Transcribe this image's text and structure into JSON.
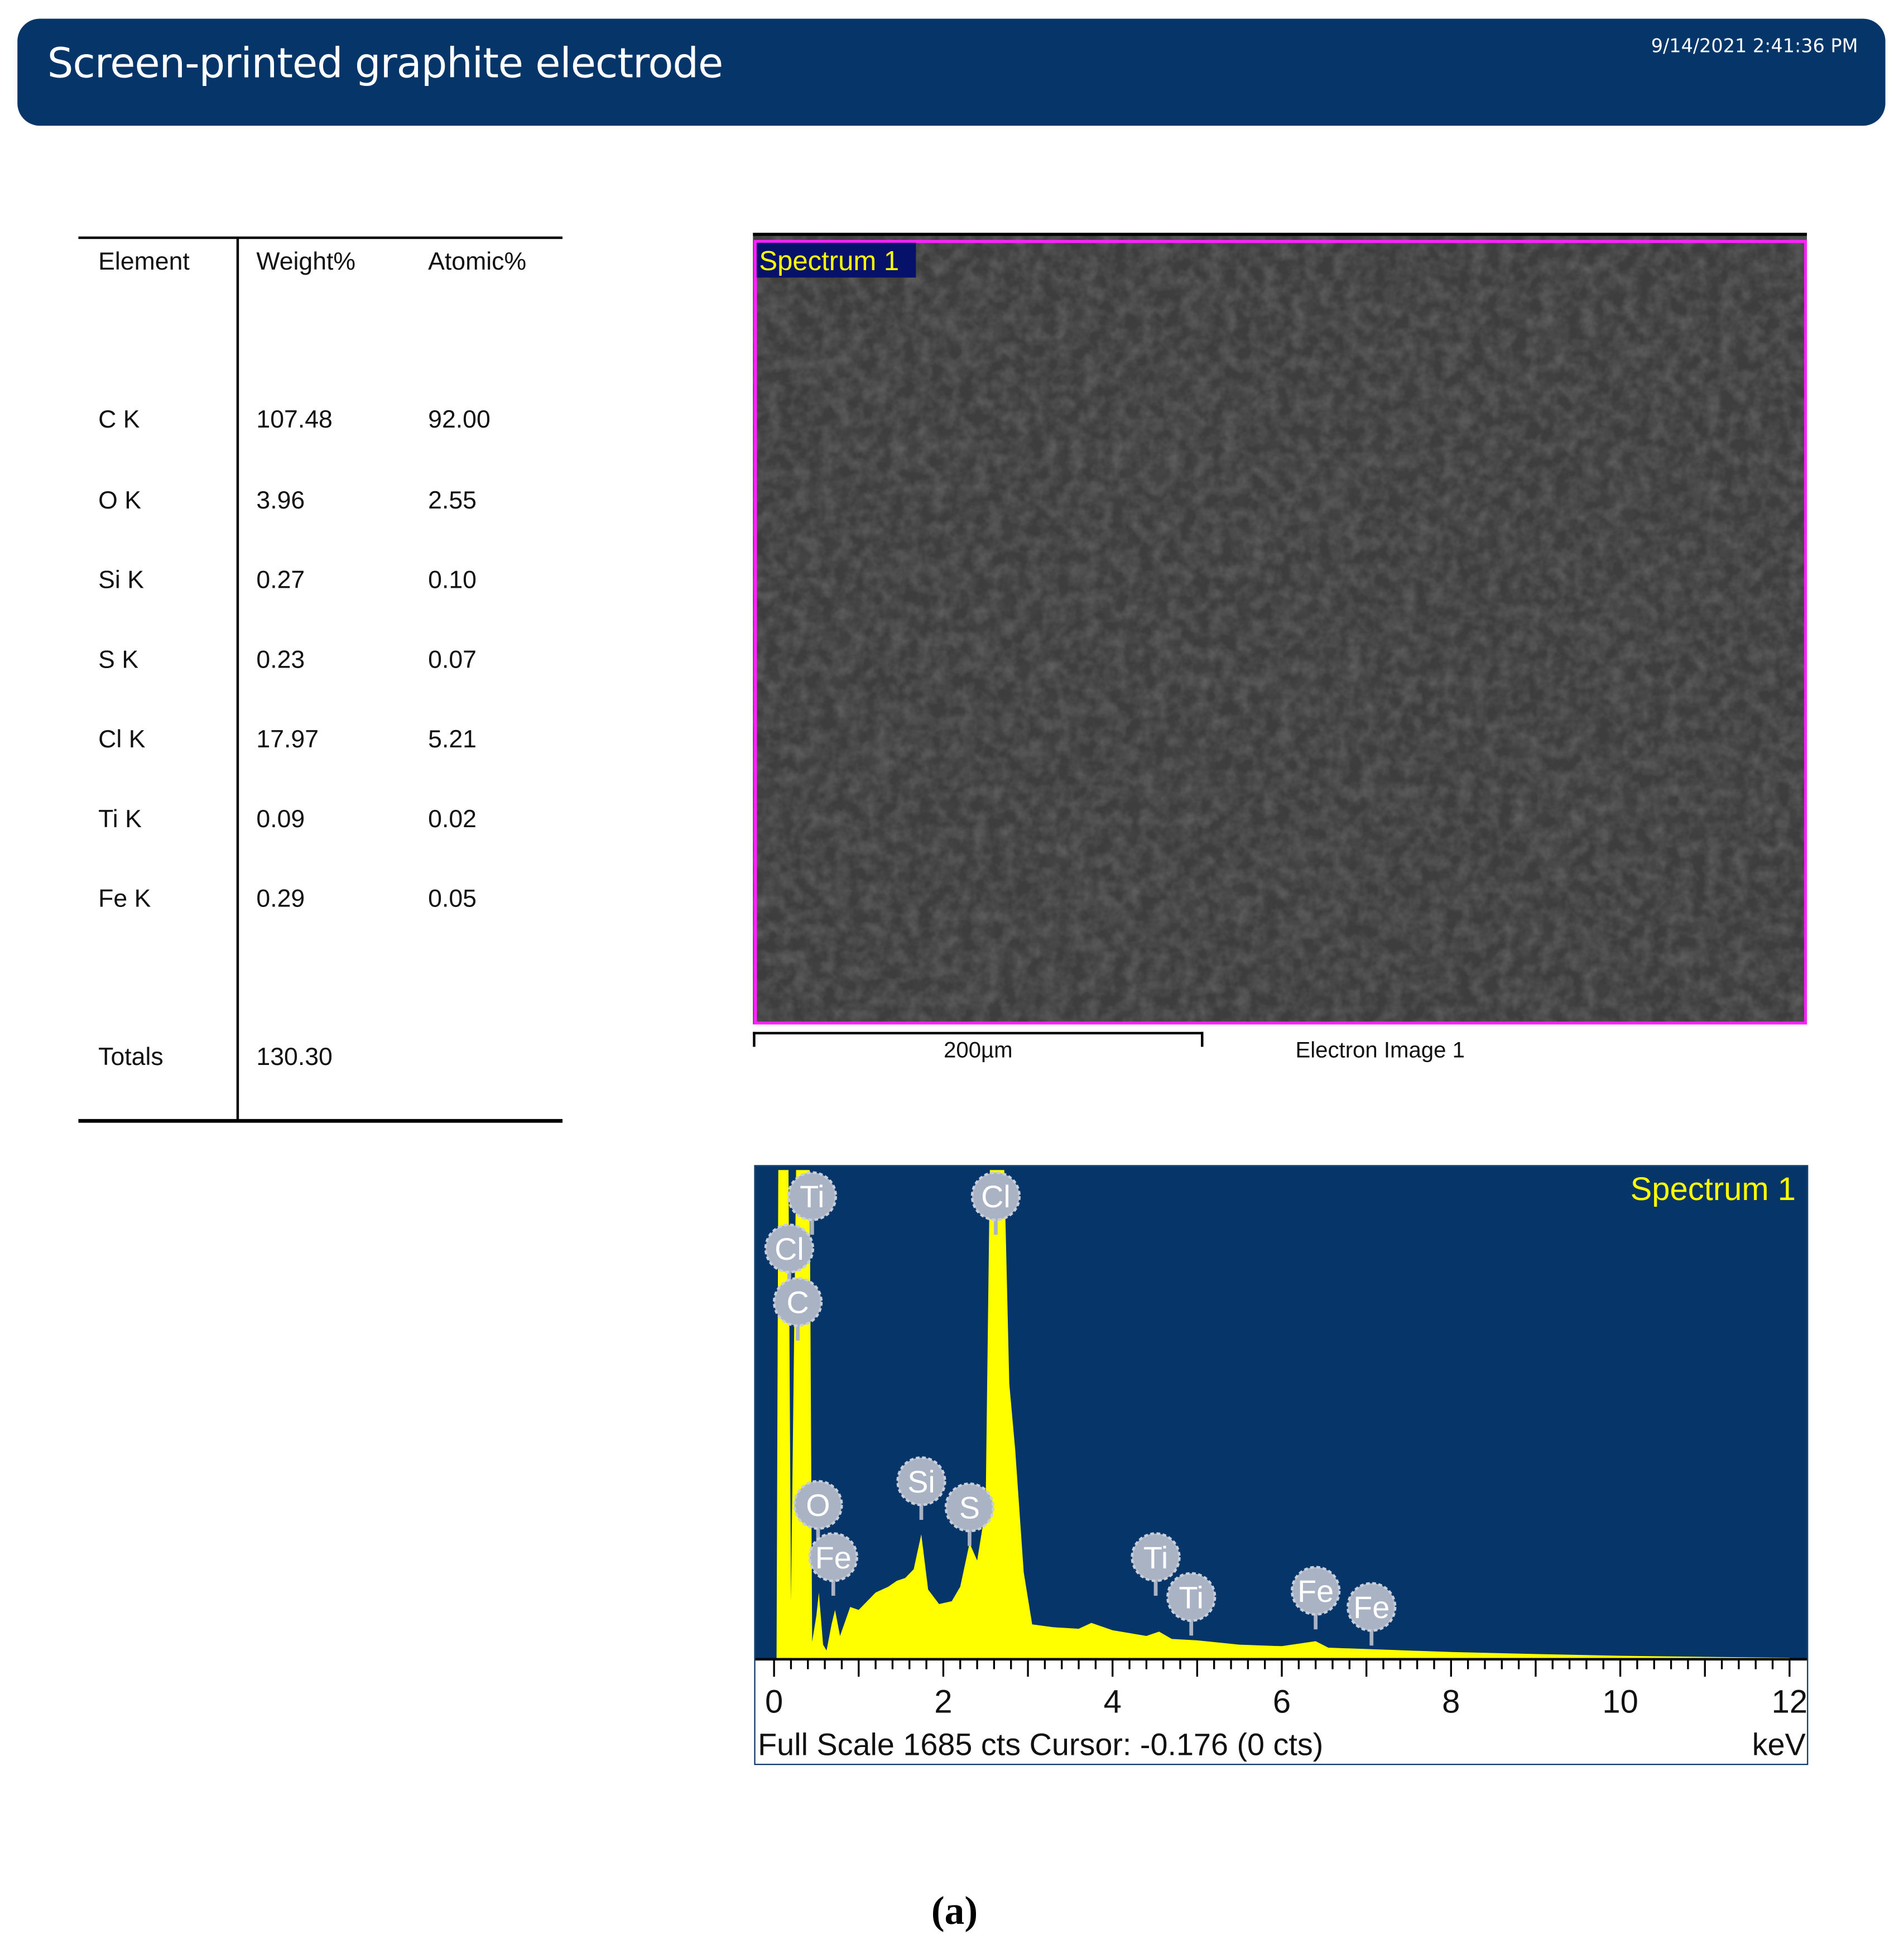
{
  "header": {
    "title": "Screen-printed graphite electrode",
    "timestamp": "9/14/2021 2:41:36 PM"
  },
  "table": {
    "columns": [
      "Element",
      "Weight%",
      "Atomic%"
    ],
    "rows": [
      [
        "C K",
        "107.48",
        "92.00"
      ],
      [
        "O K",
        "3.96",
        "2.55"
      ],
      [
        "Si K",
        "0.27",
        "0.10"
      ],
      [
        "S K",
        "0.23",
        "0.07"
      ],
      [
        "Cl K",
        "17.97",
        "5.21"
      ],
      [
        "Ti K",
        "0.09",
        "0.02"
      ],
      [
        "Fe K",
        "0.29",
        "0.05"
      ]
    ],
    "totals_label": "Totals",
    "totals_weight": "130.30"
  },
  "electron_image": {
    "spectrum_label": "Spectrum 1",
    "scale_label": "200µm",
    "caption": "Electron Image 1"
  },
  "chart_data": {
    "type": "area",
    "title": "Spectrum 1",
    "xlabel": "keV",
    "xlim": [
      0,
      12
    ],
    "ylim": [
      0,
      1685
    ],
    "xticks": [
      "0",
      "2",
      "4",
      "6",
      "8",
      "10",
      "12"
    ],
    "status": "Full Scale 1685 cts Cursor: -0.176  (0 cts)",
    "colors": {
      "background": "#06356a",
      "fill": "#ffff00",
      "marker": "#a9b3c4"
    },
    "series": [
      {
        "name": "Spectrum 1",
        "points": [
          [
            0,
            0
          ],
          [
            0.03,
            0
          ],
          [
            0.05,
            2500
          ],
          [
            0.17,
            2500
          ],
          [
            0.2,
            200
          ],
          [
            0.26,
            2500
          ],
          [
            0.42,
            2500
          ],
          [
            0.45,
            60
          ],
          [
            0.5,
            150
          ],
          [
            0.53,
            230
          ],
          [
            0.58,
            50
          ],
          [
            0.62,
            30
          ],
          [
            0.68,
            120
          ],
          [
            0.72,
            170
          ],
          [
            0.78,
            80
          ],
          [
            0.9,
            180
          ],
          [
            1.0,
            170
          ],
          [
            1.2,
            230
          ],
          [
            1.35,
            250
          ],
          [
            1.45,
            270
          ],
          [
            1.55,
            280
          ],
          [
            1.65,
            310
          ],
          [
            1.74,
            430
          ],
          [
            1.82,
            240
          ],
          [
            1.95,
            190
          ],
          [
            2.1,
            200
          ],
          [
            2.2,
            250
          ],
          [
            2.31,
            400
          ],
          [
            2.4,
            340
          ],
          [
            2.5,
            520
          ],
          [
            2.55,
            2500
          ],
          [
            2.72,
            2500
          ],
          [
            2.78,
            950
          ],
          [
            2.85,
            720
          ],
          [
            2.95,
            300
          ],
          [
            3.05,
            120
          ],
          [
            3.3,
            110
          ],
          [
            3.6,
            105
          ],
          [
            3.75,
            125
          ],
          [
            4.0,
            100
          ],
          [
            4.4,
            80
          ],
          [
            4.55,
            95
          ],
          [
            4.7,
            70
          ],
          [
            5.0,
            65
          ],
          [
            5.5,
            50
          ],
          [
            6.0,
            45
          ],
          [
            6.4,
            62
          ],
          [
            6.55,
            40
          ],
          [
            7.0,
            35
          ],
          [
            7.5,
            30
          ],
          [
            8.0,
            25
          ],
          [
            9.0,
            18
          ],
          [
            10.0,
            12
          ],
          [
            11.0,
            8
          ],
          [
            12.0,
            5
          ],
          [
            12.0,
            0
          ]
        ]
      }
    ],
    "peak_labels": [
      {
        "element": "Ti",
        "kev": 0.45
      },
      {
        "element": "Cl",
        "kev": 0.18
      },
      {
        "element": "C",
        "kev": 0.28
      },
      {
        "element": "O",
        "kev": 0.52
      },
      {
        "element": "Fe",
        "kev": 0.7
      },
      {
        "element": "Si",
        "kev": 1.74
      },
      {
        "element": "S",
        "kev": 2.31
      },
      {
        "element": "Cl",
        "kev": 2.62
      },
      {
        "element": "Ti",
        "kev": 4.51
      },
      {
        "element": "Ti",
        "kev": 4.93
      },
      {
        "element": "Fe",
        "kev": 6.4
      },
      {
        "element": "Fe",
        "kev": 7.06
      }
    ]
  },
  "figure_label": "(a)"
}
